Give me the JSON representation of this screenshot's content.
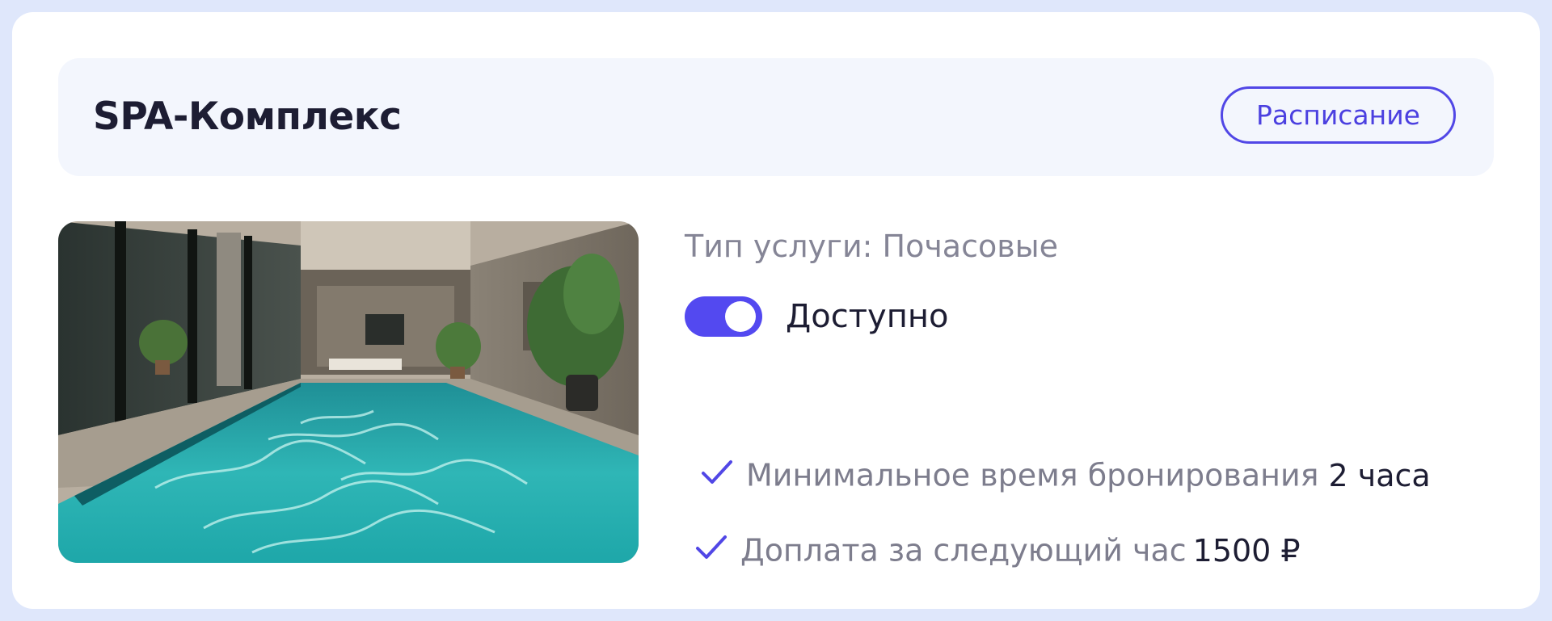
{
  "header": {
    "title": "SPA-Комплекс",
    "schedule_button_label": "Расписание"
  },
  "service": {
    "type_text": "Тип услуги: Почасовые",
    "availability_label": "Доступно",
    "availability_enabled": true,
    "photo_icon": "pool-photo"
  },
  "features": [
    {
      "icon": "check-icon",
      "label": "Минимальное время бронирования",
      "value": "2 часа"
    },
    {
      "icon": "check-icon",
      "label": "Доплата за следующий час",
      "value": "1500 ₽"
    }
  ],
  "colors": {
    "accent": "#5349f0",
    "page_background": "#dfe7fb",
    "header_background": "#f3f6fd",
    "text_primary": "#1d1d33",
    "text_muted": "#858596"
  }
}
